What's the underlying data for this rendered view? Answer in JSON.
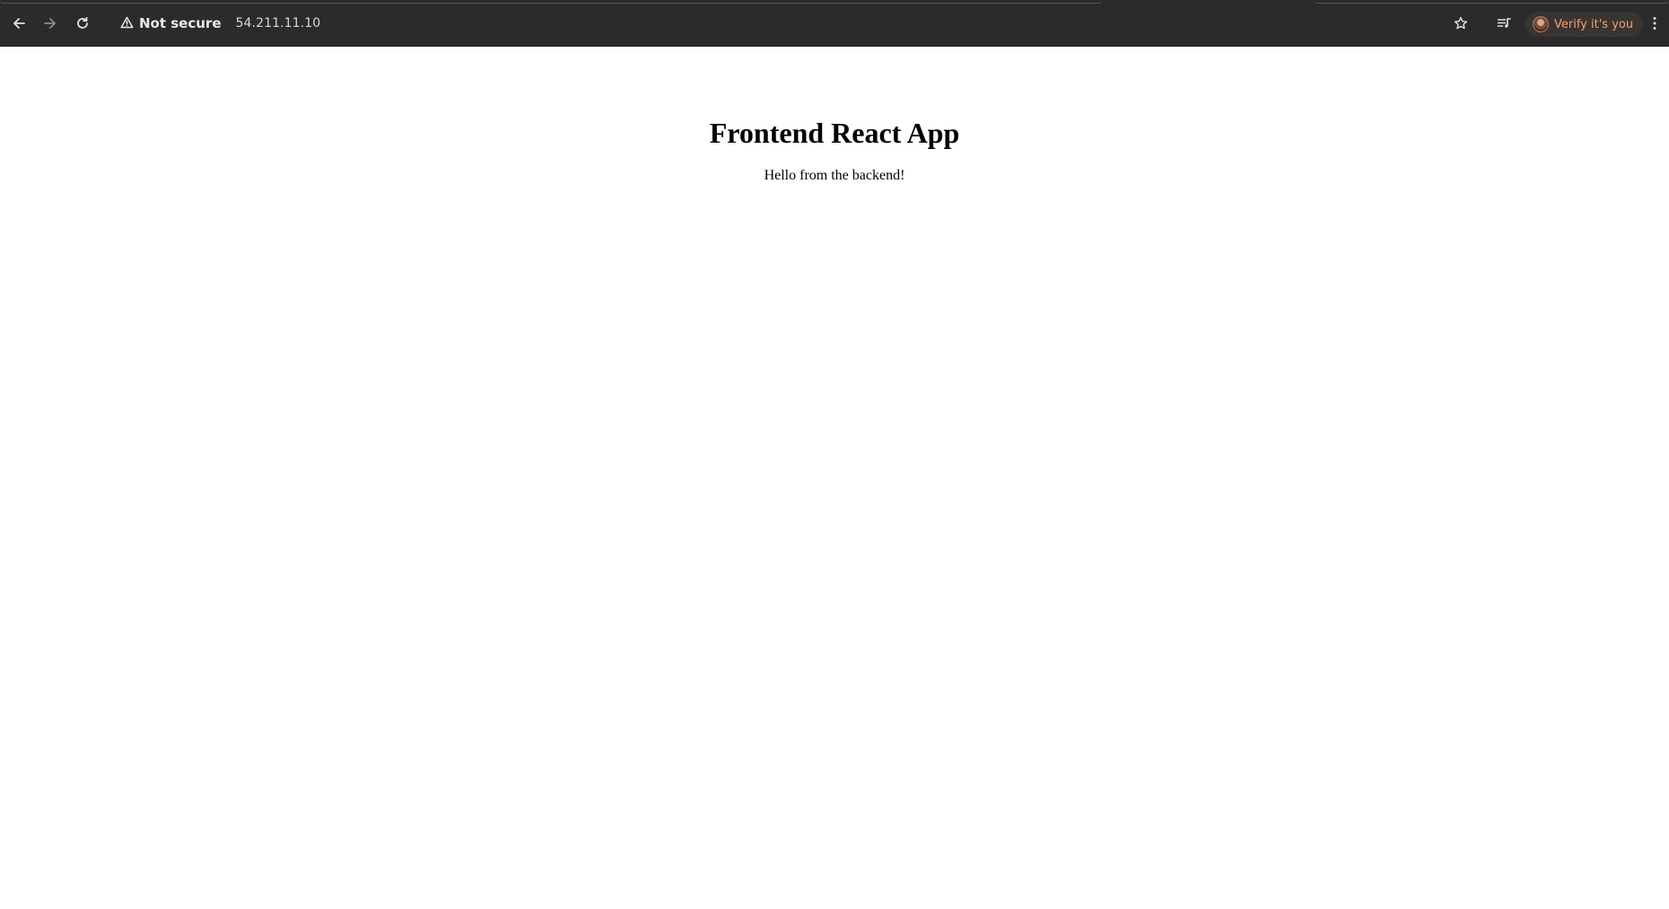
{
  "browser": {
    "security_label": "Not secure",
    "url": "54.211.11.10",
    "profile_label": "Verify it's you",
    "icons": {
      "back": "arrow-left-icon",
      "forward": "arrow-right-icon",
      "reload": "reload-icon",
      "warning": "warning-triangle-icon",
      "bookmark": "star-icon",
      "media": "media-controls-icon",
      "menu": "kebab-menu-icon"
    },
    "colors": {
      "toolbar": "#2b2b2b",
      "profile_text": "#f0a36c"
    }
  },
  "page": {
    "title": "Frontend React App",
    "message": "Hello from the backend!"
  }
}
